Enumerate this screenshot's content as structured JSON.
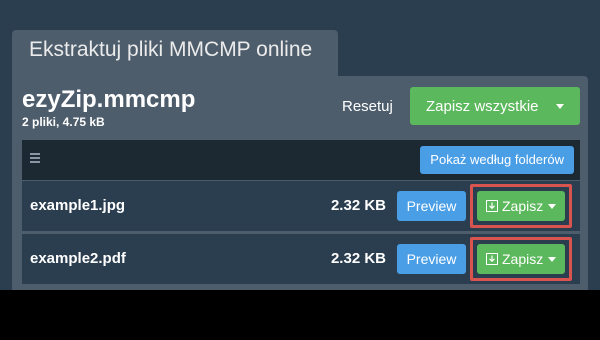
{
  "tab": {
    "title": "Ekstraktuj pliki MMCMP online"
  },
  "archive": {
    "name": "ezyZip.mmcmp",
    "info": "2 pliki, 4.75 kB"
  },
  "actions": {
    "reset_label": "Resetuj",
    "save_all_label": "Zapisz wszystkie"
  },
  "toolbar": {
    "folders_label": "Pokaż według folderów"
  },
  "files": [
    {
      "name": "example1.jpg",
      "size": "2.32 KB",
      "preview_label": "Preview",
      "save_label": "Zapisz"
    },
    {
      "name": "example2.pdf",
      "size": "2.32 KB",
      "preview_label": "Preview",
      "save_label": "Zapisz"
    }
  ],
  "icons": {
    "menu": "hamburger-icon",
    "download": "download-icon",
    "dropdown": "caret-down-icon"
  },
  "colors": {
    "background": "#2b3e50",
    "panel": "#4e5d6c",
    "toolbar": "#1c2933",
    "success": "#5cb85c",
    "info": "#4a9ee6",
    "highlight": "#d9534f"
  }
}
